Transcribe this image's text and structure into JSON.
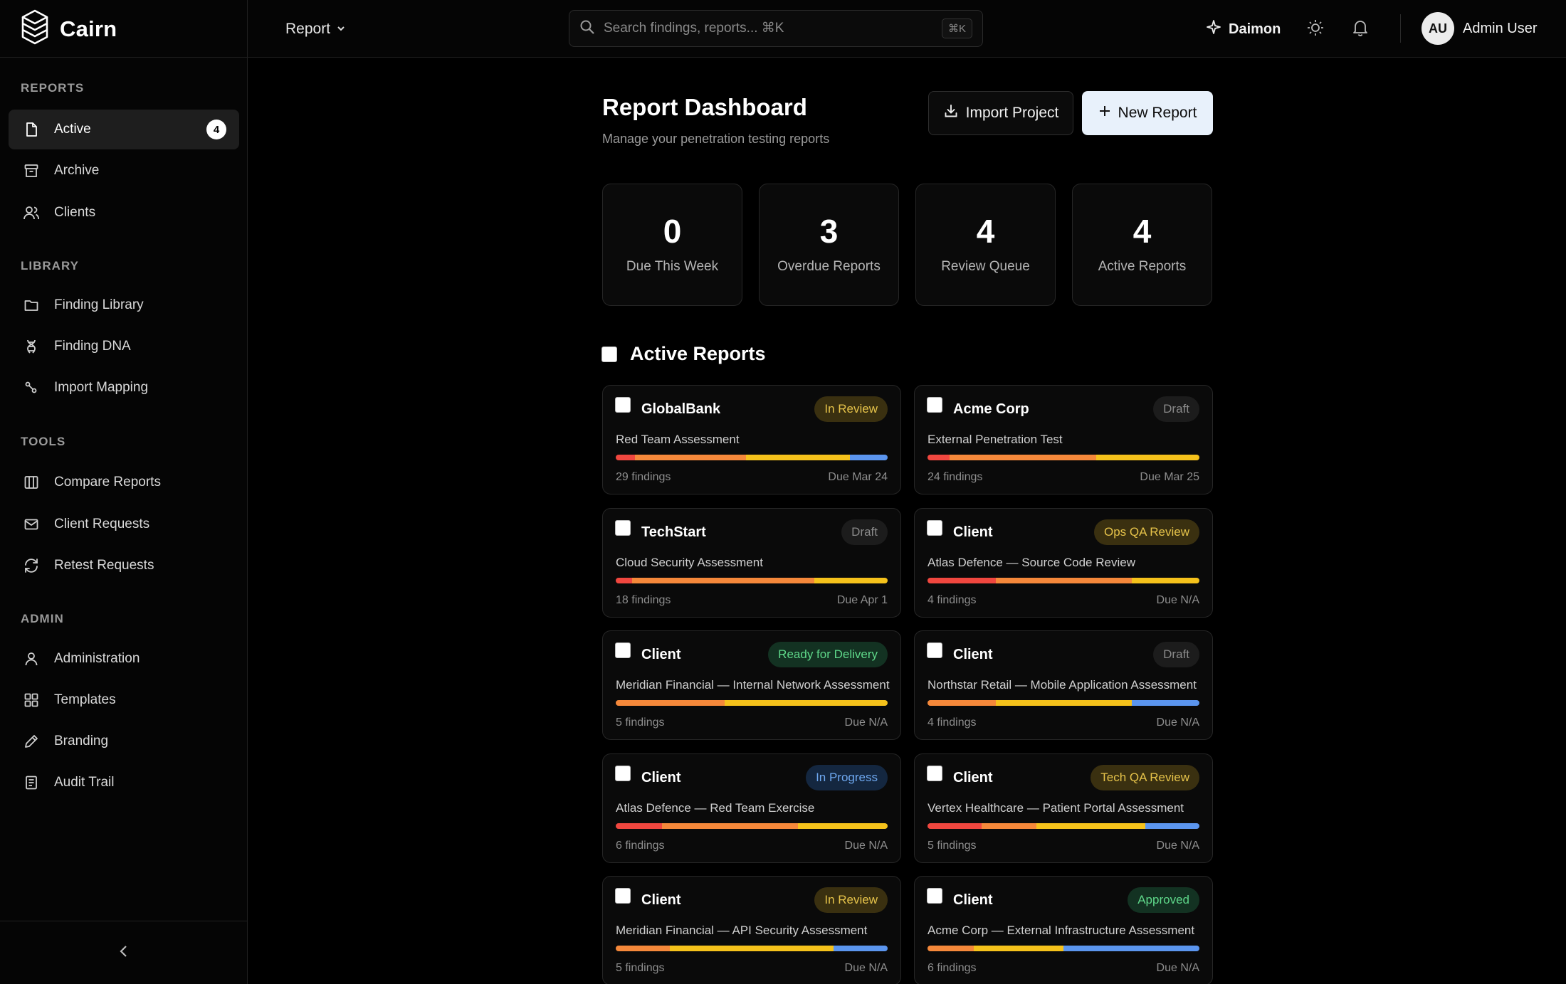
{
  "app": {
    "name": "Cairn"
  },
  "topbar": {
    "report_menu": "Report",
    "search_placeholder": "Search findings, reports... ⌘K",
    "search_shortcut": "⌘K",
    "daimon_label": "Daimon",
    "user_initials": "AU",
    "user_name": "Admin User"
  },
  "sidebar": {
    "sections": {
      "reports": "REPORTS",
      "library": "LIBRARY",
      "tools": "TOOLS",
      "admin": "ADMIN"
    },
    "items": {
      "active": {
        "label": "Active",
        "icon": "document-icon",
        "badge": "4"
      },
      "archive": {
        "label": "Archive",
        "icon": "archive-icon"
      },
      "clients": {
        "label": "Clients",
        "icon": "users-icon"
      },
      "finding_library": {
        "label": "Finding Library",
        "icon": "folder-icon"
      },
      "finding_dna": {
        "label": "Finding DNA",
        "icon": "dna-icon"
      },
      "import_mapping": {
        "label": "Import Mapping",
        "icon": "mapping-icon"
      },
      "compare_reports": {
        "label": "Compare Reports",
        "icon": "columns-icon"
      },
      "client_requests": {
        "label": "Client Requests",
        "icon": "mail-icon"
      },
      "retest_requests": {
        "label": "Retest Requests",
        "icon": "refresh-icon"
      },
      "administration": {
        "label": "Administration",
        "icon": "user-icon"
      },
      "templates": {
        "label": "Templates",
        "icon": "grid-icon"
      },
      "branding": {
        "label": "Branding",
        "icon": "pencil-icon"
      },
      "audit_trail": {
        "label": "Audit Trail",
        "icon": "clipboard-icon"
      }
    }
  },
  "main": {
    "title": "Report Dashboard",
    "subtitle": "Manage your penetration testing reports",
    "import_button": "Import Project",
    "new_button": "New Report",
    "stats": [
      {
        "value": "0",
        "label": "Due This Week"
      },
      {
        "value": "3",
        "label": "Overdue Reports"
      },
      {
        "value": "4",
        "label": "Review Queue"
      },
      {
        "value": "4",
        "label": "Active Reports"
      }
    ],
    "section_title": "Active Reports",
    "reports": [
      {
        "client": "GlobalBank",
        "status": "In Review",
        "status_color": "#e6c34a",
        "status_bg": "#3a3010",
        "project": "Red Team Assessment",
        "findings": "29 findings",
        "due": "Due Mar 24",
        "severity_mix": [
          0.07,
          0.41,
          0.38,
          0.14
        ]
      },
      {
        "client": "Acme Corp",
        "status": "Draft",
        "status_color": "#8a8a8a",
        "status_bg": "#1c1c1c",
        "project": "External Penetration Test",
        "findings": "24 findings",
        "due": "Due Mar 25",
        "severity_mix": [
          0.08,
          0.54,
          0.38,
          0
        ]
      },
      {
        "client": "TechStart",
        "status": "Draft",
        "status_color": "#8a8a8a",
        "status_bg": "#1c1c1c",
        "project": "Cloud Security Assessment",
        "findings": "18 findings",
        "due": "Due Apr 1",
        "severity_mix": [
          0.06,
          0.67,
          0.27,
          0
        ]
      },
      {
        "client": "Client",
        "status": "Ops QA Review",
        "status_color": "#e6c34a",
        "status_bg": "#3a3010",
        "project": "Atlas Defence — Source Code Review",
        "findings": "4 findings",
        "due": "Due N/A",
        "severity_mix": [
          0.25,
          0.5,
          0.25,
          0
        ]
      },
      {
        "client": "Client",
        "status": "Ready for Delivery",
        "status_color": "#5fd88a",
        "status_bg": "#133222",
        "project": "Meridian Financial — Internal Network Assessment",
        "findings": "5 findings",
        "due": "Due N/A",
        "severity_mix": [
          0,
          0.4,
          0.6,
          0
        ]
      },
      {
        "client": "Client",
        "status": "Draft",
        "status_color": "#8a8a8a",
        "status_bg": "#1c1c1c",
        "project": "Northstar Retail — Mobile Application Assessment",
        "findings": "4 findings",
        "due": "Due N/A",
        "severity_mix": [
          0,
          0.25,
          0.5,
          0.25
        ]
      },
      {
        "client": "Client",
        "status": "In Progress",
        "status_color": "#6ea8f0",
        "status_bg": "#142740",
        "project": "Atlas Defence — Red Team Exercise",
        "findings": "6 findings",
        "due": "Due N/A",
        "severity_mix": [
          0.17,
          0.5,
          0.33,
          0
        ]
      },
      {
        "client": "Client",
        "status": "Tech QA Review",
        "status_color": "#e6c34a",
        "status_bg": "#3a3010",
        "project": "Vertex Healthcare — Patient Portal Assessment",
        "findings": "5 findings",
        "due": "Due N/A",
        "severity_mix": [
          0.2,
          0.2,
          0.4,
          0.2
        ]
      },
      {
        "client": "Client",
        "status": "In Review",
        "status_color": "#e6c34a",
        "status_bg": "#3a3010",
        "project": "Meridian Financial — API Security Assessment",
        "findings": "5 findings",
        "due": "Due N/A",
        "severity_mix": [
          0,
          0.2,
          0.6,
          0.2
        ]
      },
      {
        "client": "Client",
        "status": "Approved",
        "status_color": "#5fd88a",
        "status_bg": "#133222",
        "project": "Acme Corp — External Infrastructure Assessment",
        "findings": "6 findings",
        "due": "Due N/A",
        "severity_mix": [
          0,
          0.17,
          0.33,
          0.5
        ]
      }
    ],
    "severity_colors": [
      "#f0473f",
      "#f5883a",
      "#f5c21b",
      "#5b95ee"
    ]
  }
}
